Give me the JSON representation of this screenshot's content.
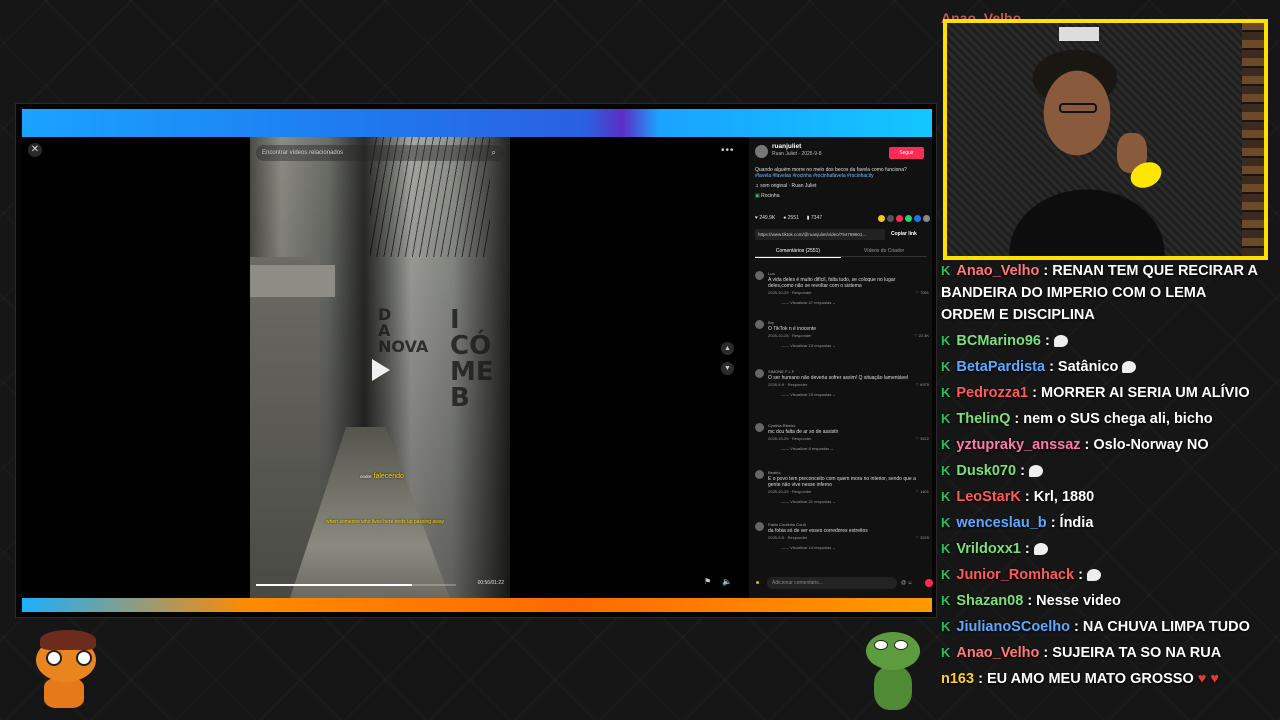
{
  "tiktok": {
    "search_placeholder": "Encontrar vídeos relacionados",
    "subtitle_prefix": "ondre",
    "subtitle_main": "falecendo",
    "subtitle_en": "when someone who lives here ends up passing away",
    "video_time": "00:56/01:22",
    "video_progress": 0.78,
    "author": {
      "handle": "ruanjuliet",
      "name_date": "Ruan Juliet · 2025-9-8",
      "follow_label": "Seguir"
    },
    "description": "Quando alguém morre no meio dos becos da favela como funciona?",
    "hashtags": "#favela #favelas #rocinha #rocinhafavela #rocinhacity",
    "music": "som original · Ruan Juliet",
    "location": "Rocinha",
    "stats": {
      "likes": "249.9K",
      "comments": "2551",
      "saves": "7347"
    },
    "link": "https://www.tiktok.com/@ruanjuliet/video/754769601...",
    "copy_label": "Copiar link",
    "tab_comments": "Comentários (2551)",
    "tab_creator": "Vídeos do Criador",
    "reply_label": "Responder",
    "add_comment_placeholder": "Adicionar comentário...",
    "comments": [
      {
        "user": "Lua",
        "text": "A vida deles é muito difícil, falta tudo, se coloque no lugar deles,como não se revoltar com o sistema",
        "date": "2025-10-29",
        "likes": "7051",
        "replies": "Visualizar 47 respostas"
      },
      {
        "user": "Bry",
        "text": "O TikTok n é inocente",
        "date": "2025-10-28",
        "likes": "22.3K",
        "replies": "Visualizar 15 respostas"
      },
      {
        "user": "SIMONE F L F",
        "text": "O ser humano não deveria sofrer assim! Q situação lamentável",
        "date": "2025-9-9",
        "likes": "6975",
        "replies": "Visualizar 15 respostas"
      },
      {
        "user": "Cynthia Ribeiro",
        "text": "mc dcu falta de ar so de assistir",
        "date": "2025-10-29",
        "likes": "3422",
        "replies": "Visualizar 8 respostas"
      },
      {
        "user": "Beatriz.",
        "text": "E o povo tem preconceito com quem mora no interior, sendo que a gente não vive nesse inferno",
        "date": "2025-10-29",
        "likes": "1401",
        "replies": "Visualizar 21 respostas"
      },
      {
        "user": "Fabio Coutinho Couti",
        "text": "da fobia só de ver esses corredores estreitos",
        "date": "2025-9-9",
        "likes": "3229",
        "replies": "Visualizar 14 respostas"
      }
    ]
  },
  "chat": {
    "badge_color": "#25c15a",
    "partial_top": "Anao_Velho",
    "messages": [
      {
        "user": "Anao_Velho",
        "color": "#ff7a7a",
        "text": ": RENAN TEM QUE RECIRAR A BANDEIRA DO IMPERIO COM O LEMA ORDEM E DISCIPLINA",
        "badge": "K"
      },
      {
        "user": "BCMarino96",
        "color": "#7be07b",
        "text": ":",
        "badge": "K"
      },
      {
        "user": "BetaPardista",
        "color": "#5fa8ff",
        "text": ": Satânico",
        "badge": "K"
      },
      {
        "user": "Pedrozza1",
        "color": "#ff5a5a",
        "text": ": MORRER AI SERIA UM ALÍVIO",
        "badge": "K"
      },
      {
        "user": "ThelinQ",
        "color": "#7be07b",
        "text": ": nem o SUS chega ali, bicho",
        "badge": "K"
      },
      {
        "user": "yztupraky_anssaz",
        "color": "#ff7aa8",
        "text": ": Oslo-Norway NO",
        "badge": "K"
      },
      {
        "user": "Dusk070",
        "color": "#7be07b",
        "text": ":",
        "badge": "K"
      },
      {
        "user": "LeoStarK",
        "color": "#ff5a5a",
        "text": ": Krl, 1880",
        "badge": "K"
      },
      {
        "user": "wenceslau_b",
        "color": "#5fa8ff",
        "text": ": Índia",
        "badge": "K"
      },
      {
        "user": "Vrildoxx1",
        "color": "#7be07b",
        "text": ":",
        "badge": "K"
      },
      {
        "user": "Junior_Romhack",
        "color": "#ff5a5a",
        "text": ":",
        "badge": "K"
      },
      {
        "user": "Shazan08",
        "color": "#7be07b",
        "text": ": Nesse video",
        "badge": "K"
      },
      {
        "user": "JiulianoSCoelho",
        "color": "#5fa8ff",
        "text": ": NA CHUVA LIMPA TUDO",
        "badge": "K"
      },
      {
        "user": "Anao_Velho",
        "color": "#ff7a7a",
        "text": ": SUJEIRA TA SO NA RUA",
        "badge": "K"
      },
      {
        "user": "n163",
        "color": "#ffcc33",
        "text": ": EU AMO MEU MATO GROSSO",
        "badge": ""
      }
    ]
  },
  "icons": {
    "close": "close-icon",
    "more": "more-icon",
    "play": "play-icon",
    "up": "chevron-up-icon",
    "down": "chevron-down-icon",
    "volume": "volume-icon",
    "search": "search-icon"
  }
}
